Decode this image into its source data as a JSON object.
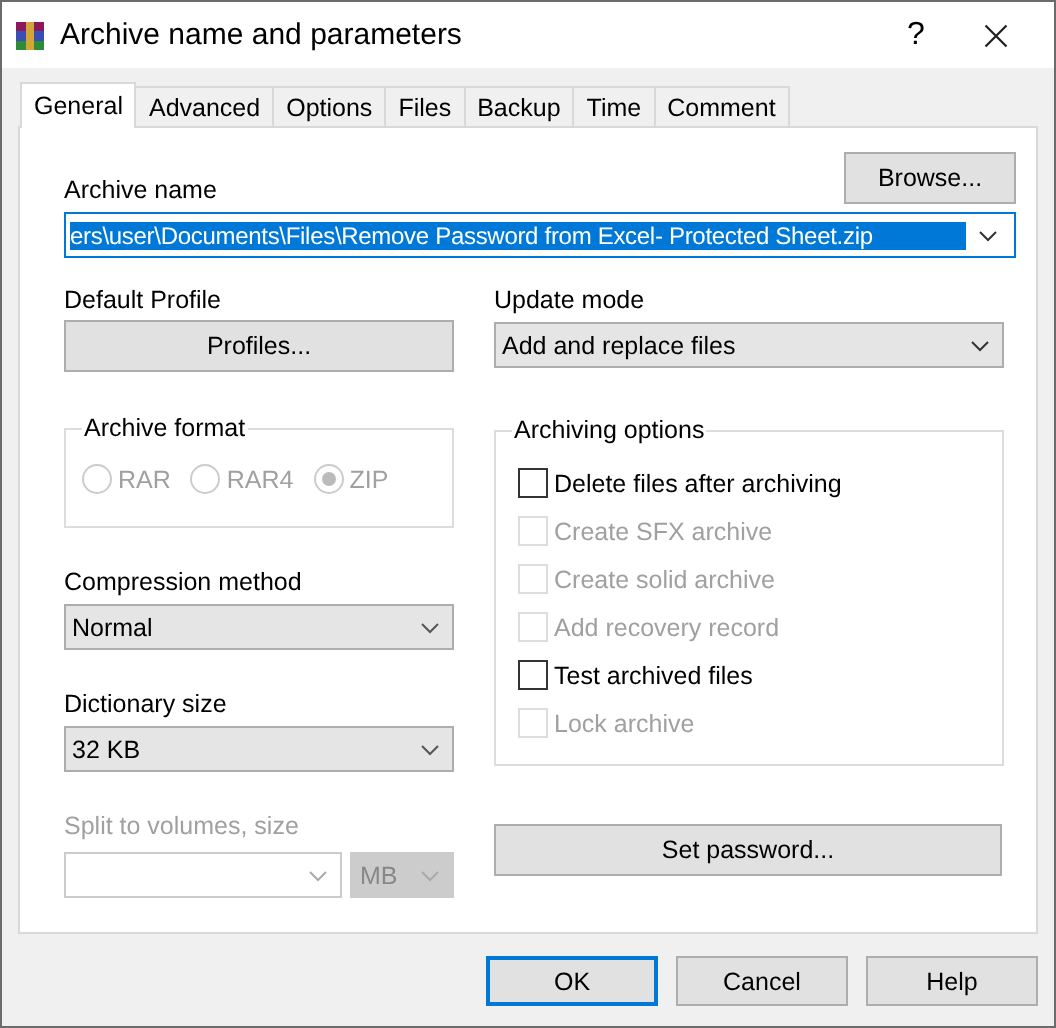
{
  "window": {
    "title": "Archive name and parameters",
    "help_button": "?"
  },
  "tabs": [
    {
      "label": "General",
      "selected": true
    },
    {
      "label": "Advanced",
      "selected": false
    },
    {
      "label": "Options",
      "selected": false
    },
    {
      "label": "Files",
      "selected": false
    },
    {
      "label": "Backup",
      "selected": false
    },
    {
      "label": "Time",
      "selected": false
    },
    {
      "label": "Comment",
      "selected": false
    }
  ],
  "archive_name": {
    "label": "Archive name",
    "value": "ers\\user\\Documents\\Files\\Remove Password from Excel- Protected Sheet.zip",
    "browse_button": "Browse..."
  },
  "default_profile": {
    "label": "Default Profile",
    "button": "Profiles..."
  },
  "update_mode": {
    "label": "Update mode",
    "value": "Add and replace files"
  },
  "archive_format": {
    "title": "Archive format",
    "options": [
      {
        "label": "RAR",
        "selected": false,
        "disabled": true
      },
      {
        "label": "RAR4",
        "selected": false,
        "disabled": true
      },
      {
        "label": "ZIP",
        "selected": true,
        "disabled": true
      }
    ]
  },
  "compression_method": {
    "label": "Compression method",
    "value": "Normal"
  },
  "dictionary_size": {
    "label": "Dictionary size",
    "value": "32 KB"
  },
  "split_volumes": {
    "label": "Split to volumes, size",
    "unit": "MB",
    "disabled": true
  },
  "archiving_options": {
    "title": "Archiving options",
    "options": [
      {
        "label": "Delete files after archiving",
        "checked": false,
        "disabled": false
      },
      {
        "label": "Create SFX archive",
        "checked": false,
        "disabled": true
      },
      {
        "label": "Create solid archive",
        "checked": false,
        "disabled": true
      },
      {
        "label": "Add recovery record",
        "checked": false,
        "disabled": true
      },
      {
        "label": "Test archived files",
        "checked": false,
        "disabled": false
      },
      {
        "label": "Lock archive",
        "checked": false,
        "disabled": true
      }
    ]
  },
  "set_password_button": "Set password...",
  "buttons": [
    {
      "label": "OK",
      "default": true
    },
    {
      "label": "Cancel",
      "default": false
    },
    {
      "label": "Help",
      "default": false
    }
  ]
}
